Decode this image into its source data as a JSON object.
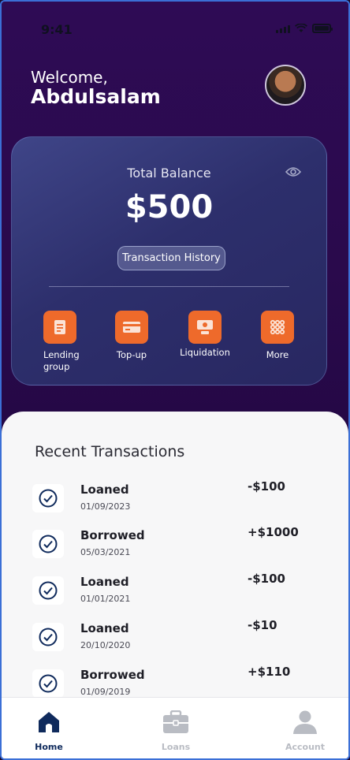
{
  "status_bar": {
    "time": "9:41"
  },
  "header": {
    "greeting": "Welcome,",
    "user_name": "Abdulsalam"
  },
  "balance_card": {
    "label": "Total Balance",
    "amount": "$500",
    "history_button": "Transaction History",
    "actions": [
      {
        "label": "Lending group",
        "icon": "document-icon"
      },
      {
        "label": "Top-up",
        "icon": "card-icon"
      },
      {
        "label": "Liquidation",
        "icon": "cash-icon"
      },
      {
        "label": "More",
        "icon": "grid-icon"
      }
    ]
  },
  "recent": {
    "title": "Recent Transactions",
    "items": [
      {
        "type": "Loaned",
        "date": "01/09/2023",
        "amount": "-$100"
      },
      {
        "type": "Borrowed",
        "date": "05/03/2021",
        "amount": "+$1000"
      },
      {
        "type": "Loaned",
        "date": "01/01/2021",
        "amount": "-$100"
      },
      {
        "type": "Loaned",
        "date": "20/10/2020",
        "amount": "-$10"
      },
      {
        "type": "Borrowed",
        "date": "01/09/2019",
        "amount": "+$110"
      }
    ]
  },
  "bottom_nav": {
    "items": [
      {
        "label": "Home",
        "icon": "home-icon",
        "active": true
      },
      {
        "label": "Loans",
        "icon": "briefcase-icon",
        "active": false
      },
      {
        "label": "Account",
        "icon": "person-icon",
        "active": false
      }
    ]
  },
  "colors": {
    "background": "#2a0b4f",
    "card": "#2d2f6c",
    "accent": "#ee6a2b",
    "nav_active": "#0f2a5c",
    "nav_inactive": "#b9bcc3"
  }
}
